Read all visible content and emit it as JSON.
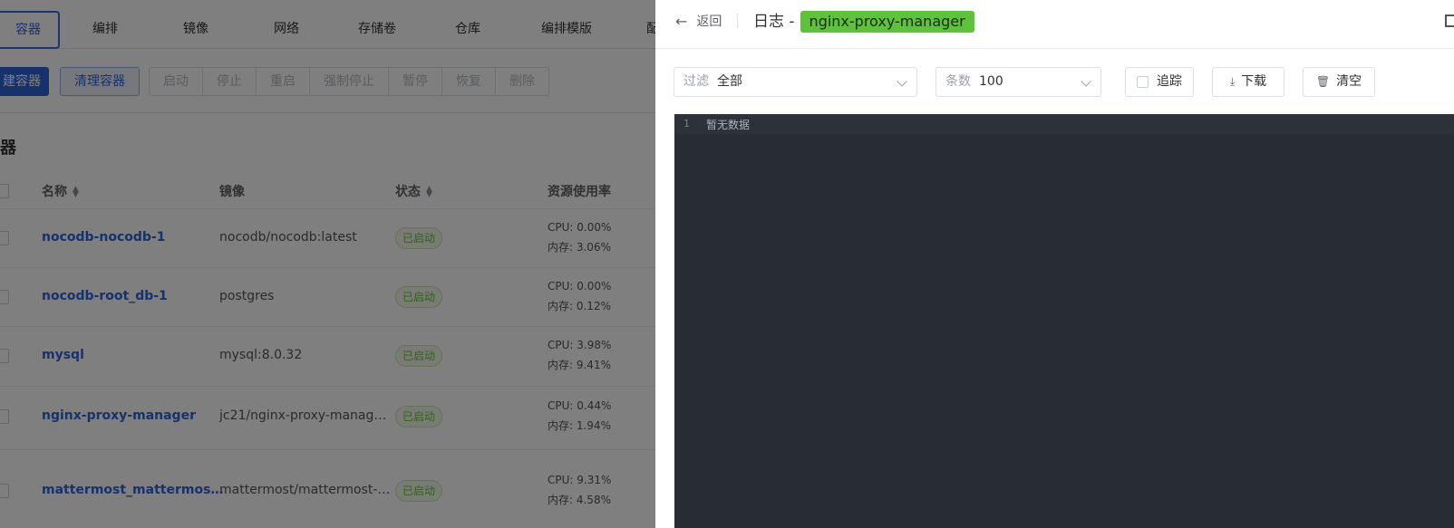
{
  "tabs": [
    "容器",
    "编排",
    "镜像",
    "网络",
    "存储卷",
    "仓库",
    "编排模版",
    "配置"
  ],
  "toolbar": {
    "create": "建容器",
    "clean": "清理容器",
    "group": [
      "启动",
      "停止",
      "重启",
      "强制停止",
      "暂停",
      "恢复",
      "删除"
    ]
  },
  "section_title": "容器",
  "table": {
    "headers": {
      "name": "名称",
      "image": "镜像",
      "status": "状态",
      "resource": "资源使用率"
    },
    "rows": [
      {
        "name": "nocodb-nocodb-1",
        "image": "nocodb/nocodb:latest",
        "status": "已启动",
        "cpu": "CPU: 0.00%",
        "mem": "内存: 3.06%"
      },
      {
        "name": "nocodb-root_db-1",
        "image": "postgres",
        "status": "已启动",
        "cpu": "CPU: 0.00%",
        "mem": "内存: 0.12%"
      },
      {
        "name": "mysql",
        "image": "mysql:8.0.32",
        "status": "已启动",
        "cpu": "CPU: 3.98%",
        "mem": "内存: 9.41%"
      },
      {
        "name": "nginx-proxy-manager",
        "image": "jc21/nginx-proxy-manag…",
        "status": "已启动",
        "cpu": "CPU: 0.44%",
        "mem": "内存: 1.94%"
      },
      {
        "name": "mattermost_mattermos…",
        "image": "mattermost/mattermost-…",
        "status": "已启动",
        "cpu": "CPU: 9.31%",
        "mem": "内存: 4.58%"
      }
    ]
  },
  "drawer": {
    "back": "返回",
    "title": "日志 -",
    "tag": "nginx-proxy-manager",
    "filter": {
      "label": "过滤",
      "value": "全部"
    },
    "count": {
      "label": "条数",
      "value": "100"
    },
    "follow": "追踪",
    "download": "下载",
    "clear": "清空",
    "log": {
      "line_no": "1",
      "text": "暂无数据"
    }
  },
  "colors": {
    "primary": "#2f63d8",
    "tag_green": "#5cc33a",
    "log_bg": "#282c34",
    "status_green": "#67c23a"
  }
}
